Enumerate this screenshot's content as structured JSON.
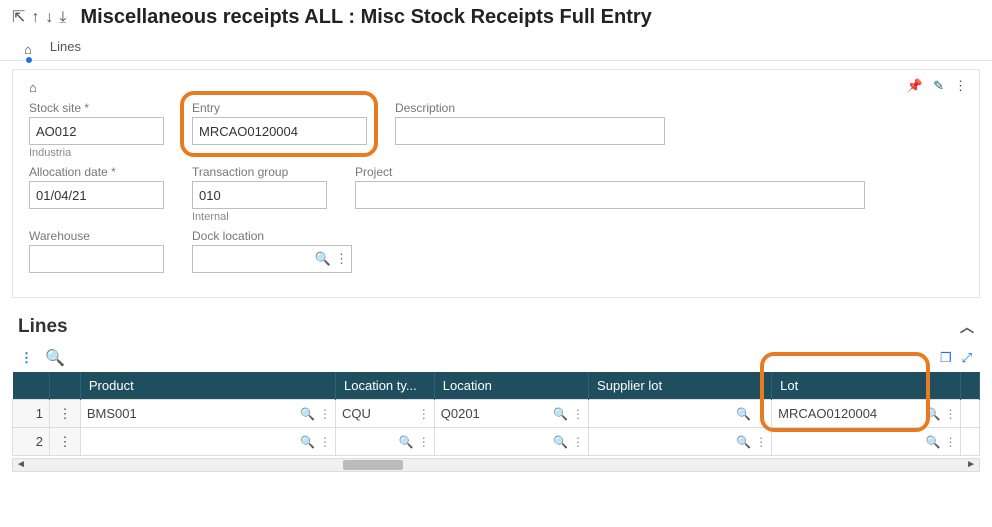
{
  "header": {
    "title": "Miscellaneous receipts ALL : Misc Stock Receipts Full Entry",
    "tabs": {
      "lines": "Lines"
    }
  },
  "form": {
    "stock_site": {
      "label": "Stock site",
      "value": "AO012",
      "sub": "Industria"
    },
    "entry": {
      "label": "Entry",
      "value": "MRCAO0120004"
    },
    "description": {
      "label": "Description",
      "value": ""
    },
    "allocation_date": {
      "label": "Allocation date",
      "value": "01/04/21"
    },
    "txn_group": {
      "label": "Transaction group",
      "value": "010",
      "sub": "Internal"
    },
    "project": {
      "label": "Project",
      "value": ""
    },
    "warehouse": {
      "label": "Warehouse",
      "value": ""
    },
    "dock": {
      "label": "Dock location",
      "value": ""
    }
  },
  "lines": {
    "title": "Lines",
    "columns": {
      "product": "Product",
      "loc_type": "Location ty...",
      "location": "Location",
      "supplier_lot": "Supplier lot",
      "lot": "Lot"
    },
    "rows": [
      {
        "num": "1",
        "product": "BMS001",
        "loc_type": "CQU",
        "location": "Q0201",
        "supplier_lot": "",
        "lot": "MRCAO0120004"
      },
      {
        "num": "2",
        "product": "",
        "loc_type": "",
        "location": "",
        "supplier_lot": "",
        "lot": ""
      }
    ]
  },
  "icons": {
    "search": "🔍",
    "vdots": "⋮",
    "pin": "📌",
    "pencil": "✎",
    "cube": "❒",
    "expand": "⤢"
  }
}
